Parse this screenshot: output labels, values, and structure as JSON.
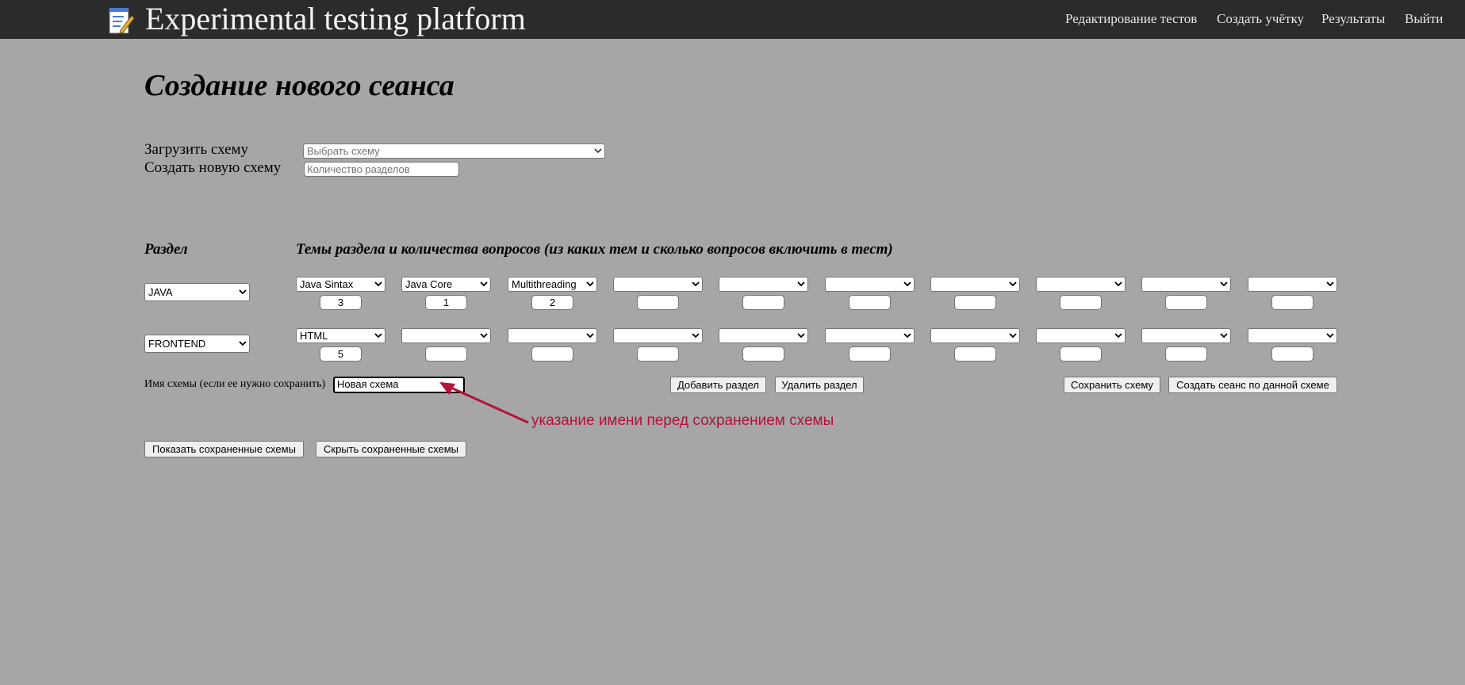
{
  "header": {
    "title": "Experimental testing platform",
    "nav": [
      {
        "label": "Редактирование тестов"
      },
      {
        "label": "Создать учётку"
      },
      {
        "label": "Результаты"
      },
      {
        "label": "Выйти"
      }
    ]
  },
  "page_title": "Создание нового сеанса",
  "load_scheme": {
    "label": "Загрузить схему",
    "placeholder": "Выбрать схему"
  },
  "new_scheme": {
    "label": "Создать новую схему",
    "placeholder": "Количество разделов"
  },
  "columns": {
    "section": "Раздел",
    "topics": "Темы раздела и количества вопросов (из каких тем и сколько вопросов включить в тест)"
  },
  "rows": [
    {
      "section": "JAVA",
      "topics": [
        "Java Sintax",
        "Java Core",
        "Multithreading",
        "",
        "",
        "",
        "",
        "",
        "",
        ""
      ],
      "counts": [
        "3",
        "1",
        "2",
        "",
        "",
        "",
        "",
        "",
        "",
        ""
      ]
    },
    {
      "section": "FRONTEND",
      "topics": [
        "HTML",
        "",
        "",
        "",
        "",
        "",
        "",
        "",
        "",
        ""
      ],
      "counts": [
        "5",
        "",
        "",
        "",
        "",
        "",
        "",
        "",
        "",
        ""
      ]
    }
  ],
  "scheme_name": {
    "label": "Имя схемы (если ее нужно сохранить)",
    "value": "Новая схема"
  },
  "buttons": {
    "add_section": "Добавить раздел",
    "remove_section": "Удалить раздел",
    "save_scheme": "Сохранить схему",
    "create_session": "Создать сеанс по данной схеме",
    "show_saved": "Показать сохраненные схемы",
    "hide_saved": "Скрыть сохраненные схемы"
  },
  "annotation": "указание имени перед сохранением схемы",
  "colors": {
    "background": "#a6a6a6",
    "header": "#2b2b2b",
    "annotation": "#b0143c"
  },
  "icons": {
    "logo": "notepad-pencil-icon",
    "dropdown": "chevron-down-icon"
  }
}
